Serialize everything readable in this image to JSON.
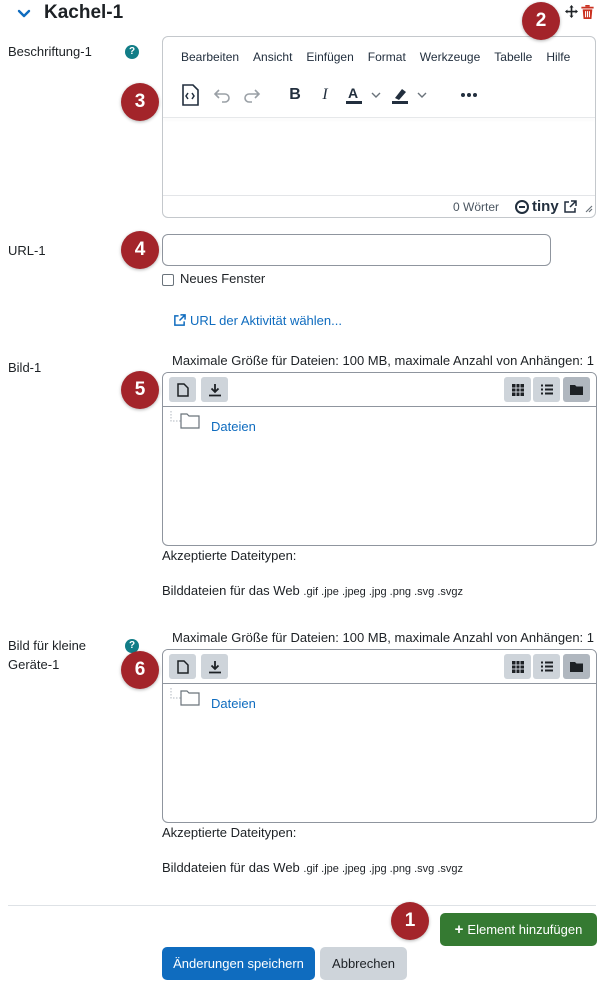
{
  "header": {
    "title": "Kachel-1"
  },
  "fields": {
    "caption_label": "Beschriftung-1",
    "url_label": "URL-1",
    "image_label": "Bild-1",
    "small_image_label": "Bild für kleine Geräte-1"
  },
  "help_icon": "?",
  "editor": {
    "menu": [
      "Bearbeiten",
      "Ansicht",
      "Einfügen",
      "Format",
      "Werkzeuge",
      "Tabelle",
      "Hilfe"
    ],
    "toolbar_icons": [
      "source-code-icon",
      "undo-icon",
      "redo-icon",
      "bold-icon",
      "italic-icon",
      "text-color-icon",
      "highlight-color-icon",
      "more-icon"
    ],
    "word_count": "0 Wörter",
    "brand": "tiny"
  },
  "url": {
    "value": "",
    "new_window_label": "Neues Fenster",
    "new_window_checked": false,
    "choose_activity_link": "URL der Aktivität wählen..."
  },
  "filepicker": {
    "max_size_text": "Maximale Größe für Dateien: 100 MB, maximale Anzahl von Anhängen: 1",
    "folder_label": "Dateien",
    "accepted_label": "Akzeptierte Dateitypen:",
    "types_label": "Bilddateien für das Web",
    "types_ext": ".gif .jpe .jpeg .jpg .png .svg .svgz",
    "view_mode_active": "folder-view"
  },
  "markers": [
    "1",
    "2",
    "3",
    "4",
    "5",
    "6"
  ],
  "footer": {
    "add_element_label": "Element hinzufügen",
    "save_label": "Änderungen speichern",
    "cancel_label": "Abbrechen"
  },
  "colors": {
    "primary": "#0f6cbf",
    "success": "#357a32",
    "danger": "#ca3120",
    "marker": "#a3242a"
  }
}
